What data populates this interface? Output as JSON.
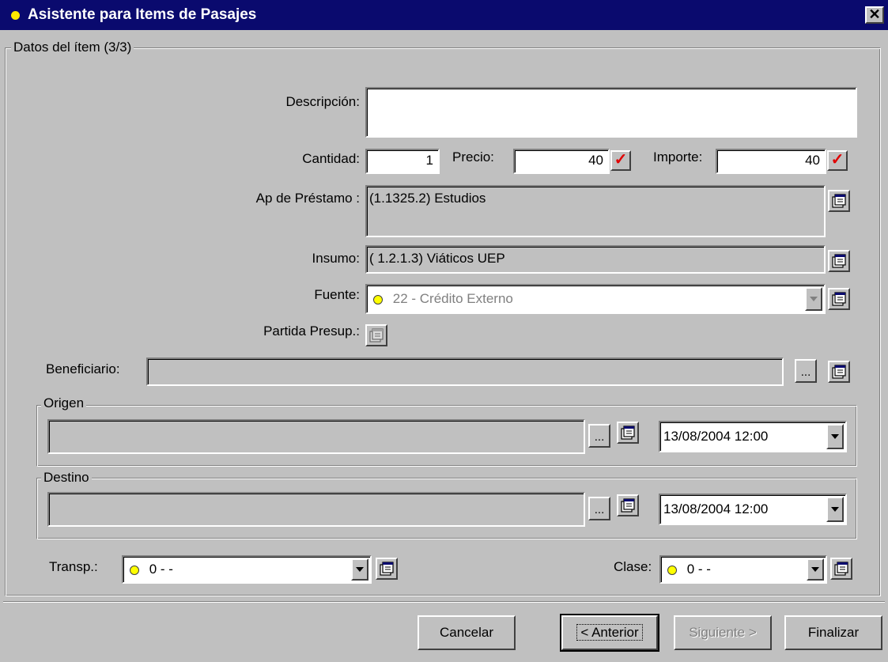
{
  "window": {
    "title": "Asistente para Items de Pasajes",
    "close_label": "✕"
  },
  "group": {
    "label": "Datos del ítem (3/3)"
  },
  "fields": {
    "descripcion_label": "Descripción:",
    "descripcion_value": "",
    "cantidad_label": "Cantidad:",
    "cantidad_value": "1",
    "precio_label": "Precio:",
    "precio_value": "40",
    "importe_label": "Importe:",
    "importe_value": "40",
    "ap_prestamo_label": "Ap de Préstamo :",
    "ap_prestamo_value": "(1.1325.2) Estudios",
    "insumo_label": "Insumo:",
    "insumo_value": "( 1.2.1.3) Viáticos UEP",
    "fuente_label": "Fuente:",
    "fuente_value": "22 - Crédito Externo",
    "partida_label": "Partida Presup.:",
    "beneficiario_label": "Beneficiario:",
    "beneficiario_value": "",
    "dots_label": "..."
  },
  "origen": {
    "label": "Origen",
    "value": "",
    "datetime": "13/08/2004  12:00"
  },
  "destino": {
    "label": "Destino",
    "value": "",
    "datetime": "13/08/2004  12:00"
  },
  "transp": {
    "label": "Transp.:",
    "value": "0 - -"
  },
  "clase": {
    "label": "Clase:",
    "value": "0 - -"
  },
  "buttons": {
    "cancelar": {
      "label": "Cancelar"
    },
    "anterior": {
      "label": "< Anterior"
    },
    "siguiente": {
      "label": "Siguiente >"
    },
    "finalizar": {
      "label": "Finalizar"
    }
  },
  "icons": {
    "check": "check-icon",
    "properties": "properties-icon",
    "status_dot": "status-dot-icon"
  },
  "colors": {
    "titlebar": "#0a0a6e",
    "window_bg": "#c0c0c0",
    "check": "#e00000",
    "status_dot": "#ffff00"
  }
}
